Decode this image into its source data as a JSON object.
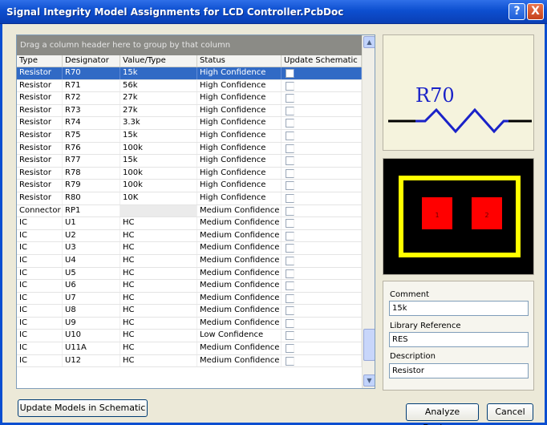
{
  "window": {
    "title": "Signal Integrity Model Assignments for LCD Controller.PcbDoc",
    "help": "?",
    "close": "X"
  },
  "grid": {
    "group_hint": "Drag a column header here to group by that column",
    "columns": [
      "Type",
      "Designator",
      "Value/Type",
      "Status",
      "Update Schematic"
    ],
    "rows": [
      {
        "type": "Resistor",
        "des": "R70",
        "val": "15k",
        "status": "High Confidence"
      },
      {
        "type": "Resistor",
        "des": "R71",
        "val": "56k",
        "status": "High Confidence"
      },
      {
        "type": "Resistor",
        "des": "R72",
        "val": "27k",
        "status": "High Confidence"
      },
      {
        "type": "Resistor",
        "des": "R73",
        "val": "27k",
        "status": "High Confidence"
      },
      {
        "type": "Resistor",
        "des": "R74",
        "val": "3.3k",
        "status": "High Confidence"
      },
      {
        "type": "Resistor",
        "des": "R75",
        "val": "15k",
        "status": "High Confidence"
      },
      {
        "type": "Resistor",
        "des": "R76",
        "val": "100k",
        "status": "High Confidence"
      },
      {
        "type": "Resistor",
        "des": "R77",
        "val": "15k",
        "status": "High Confidence"
      },
      {
        "type": "Resistor",
        "des": "R78",
        "val": "100k",
        "status": "High Confidence"
      },
      {
        "type": "Resistor",
        "des": "R79",
        "val": "100k",
        "status": "High Confidence"
      },
      {
        "type": "Resistor",
        "des": "R80",
        "val": "10K",
        "status": "High Confidence"
      },
      {
        "type": "Connector",
        "des": "RP1",
        "val": "",
        "status": "Medium Confidence"
      },
      {
        "type": "IC",
        "des": "U1",
        "val": "HC",
        "status": "Medium Confidence"
      },
      {
        "type": "IC",
        "des": "U2",
        "val": "HC",
        "status": "Medium Confidence"
      },
      {
        "type": "IC",
        "des": "U3",
        "val": "HC",
        "status": "Medium Confidence"
      },
      {
        "type": "IC",
        "des": "U4",
        "val": "HC",
        "status": "Medium Confidence"
      },
      {
        "type": "IC",
        "des": "U5",
        "val": "HC",
        "status": "Medium Confidence"
      },
      {
        "type": "IC",
        "des": "U6",
        "val": "HC",
        "status": "Medium Confidence"
      },
      {
        "type": "IC",
        "des": "U7",
        "val": "HC",
        "status": "Medium Confidence"
      },
      {
        "type": "IC",
        "des": "U8",
        "val": "HC",
        "status": "Medium Confidence"
      },
      {
        "type": "IC",
        "des": "U9",
        "val": "HC",
        "status": "Medium Confidence"
      },
      {
        "type": "IC",
        "des": "U10",
        "val": "HC",
        "status": "Low Confidence"
      },
      {
        "type": "IC",
        "des": "U11A",
        "val": "HC",
        "status": "Medium Confidence"
      },
      {
        "type": "IC",
        "des": "U12",
        "val": "HC",
        "status": "Medium Confidence"
      }
    ],
    "selected_index": 0,
    "scroll": {
      "up": "▲",
      "down": "▼"
    }
  },
  "symbol": {
    "designator": "R70",
    "color": "#1a22c8"
  },
  "footprint": {
    "pad1": "1",
    "pad2": "2",
    "pad_color": "#ff0000",
    "outline_color": "#ffff00"
  },
  "info": {
    "comment_label": "Comment",
    "comment": "15k",
    "libref_label": "Library Reference",
    "libref": "RES",
    "desc_label": "Description",
    "desc": "Resistor"
  },
  "buttons": {
    "update": "Update Models in Schematic",
    "analyze": "Analyze Design...",
    "cancel": "Cancel"
  }
}
